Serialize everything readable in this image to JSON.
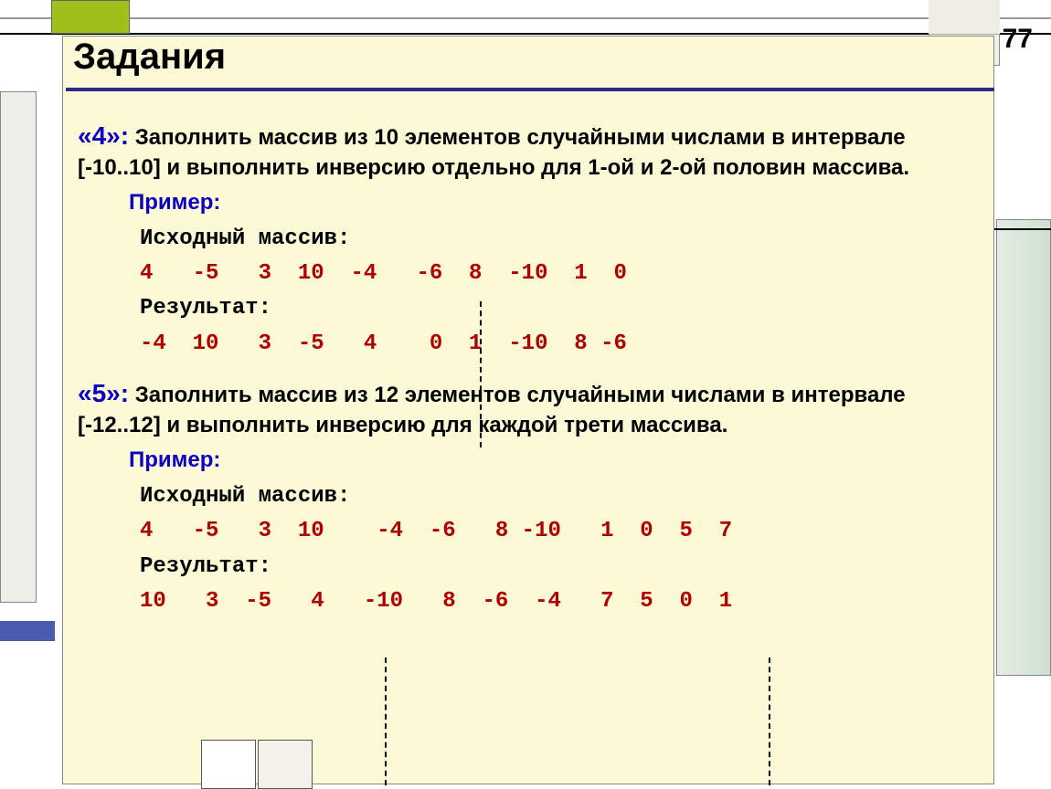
{
  "page_number": "77",
  "title": "Задания",
  "tasks": {
    "t4": {
      "grade": "«4»:",
      "text": "Заполнить массив из 10 элементов случайными числами в интервале [-10..10] и выполнить инверсию отдельно для 1-ой и 2-ой половин массива.",
      "example_label": "Пример:",
      "src_label": "Исходный массив:",
      "src_values": "4   -5   3  10  -4   -6  8  -10  1  0",
      "res_label": "Результат:",
      "res_values": "-4  10   3  -5   4    0  1  -10  8 -6"
    },
    "t5": {
      "grade": "«5»:",
      "text": "Заполнить массив из 12 элементов случайными числами в интервале [-12..12] и выполнить инверсию для каждой трети массива.",
      "example_label": "Пример:",
      "src_label": "Исходный массив:",
      "src_values": "4   -5   3  10    -4  -6   8 -10   1  0  5  7",
      "res_label": "Результат:",
      "res_values": "10   3  -5   4   -10   8  -6  -4   7  5  0  1"
    }
  }
}
